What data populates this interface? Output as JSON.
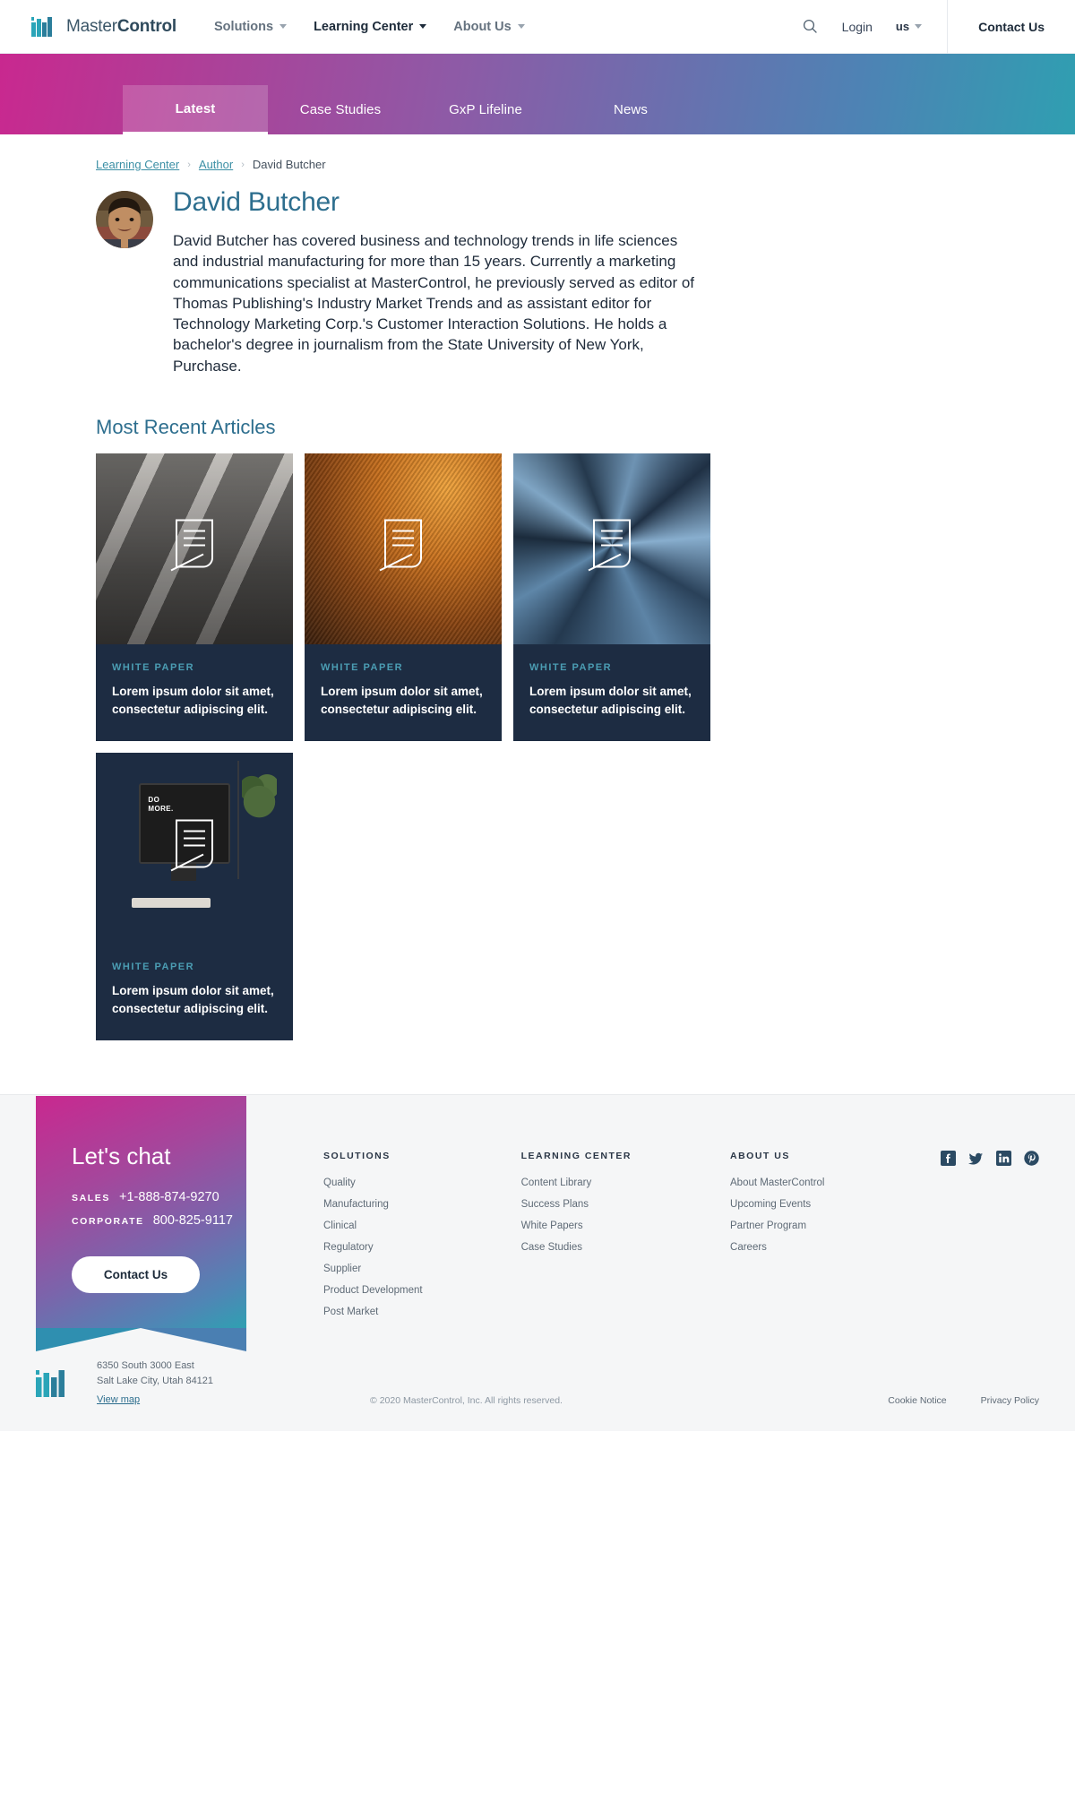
{
  "header": {
    "logo": {
      "icon": "mastercontrol-logo-icon",
      "text_light": "Master",
      "text_bold": "Control"
    },
    "nav": [
      {
        "label": "Solutions",
        "active": false,
        "has_caret": true
      },
      {
        "label": "Learning Center",
        "active": true,
        "has_caret": true
      },
      {
        "label": "About Us",
        "active": false,
        "has_caret": true
      }
    ],
    "search_icon": "search-icon",
    "login_label": "Login",
    "locale_label": "us",
    "contact_label": "Contact Us"
  },
  "tabbar": {
    "tabs": [
      {
        "label": "Latest",
        "active": true
      },
      {
        "label": "Case Studies",
        "active": false
      },
      {
        "label": "GxP Lifeline",
        "active": false
      },
      {
        "label": "News",
        "active": false
      }
    ]
  },
  "breadcrumb": {
    "items": [
      {
        "label": "Learning Center",
        "link": true
      },
      {
        "label": "Author",
        "link": true
      },
      {
        "label": "David Butcher",
        "link": false
      }
    ],
    "separator": "›"
  },
  "author": {
    "name": "David Butcher",
    "avatar_alt": "author-photo",
    "bio": "David Butcher has covered business and technology trends in life sciences and industrial manufacturing for more than 15 years. Currently a marketing communications specialist at MasterControl, he previously served as editor of Thomas Publishing's Industry Market Trends and as assistant editor for Technology Marketing Corp.'s Customer Interaction Solutions. He holds a bachelor's degree in journalism from the State University of New York, Purchase."
  },
  "articles": {
    "section_title": "Most Recent Articles",
    "cards": [
      {
        "kicker": "WHITE PAPER",
        "title": "Lorem ipsum dolor sit amet, consectetur adipiscing elit.",
        "image": "crowd-stairs-photo"
      },
      {
        "kicker": "WHITE PAPER",
        "title": "Lorem ipsum dolor sit amet, consectetur adipiscing elit.",
        "image": "amber-interior-photo"
      },
      {
        "kicker": "WHITE PAPER",
        "title": "Lorem ipsum dolor sit amet, consectetur adipiscing elit.",
        "image": "skyscrapers-photo"
      },
      {
        "kicker": "WHITE PAPER",
        "title": "Lorem ipsum dolor sit amet, consectetur adipiscing elit.",
        "image": "desk-monitor-photo"
      }
    ]
  },
  "footer": {
    "chat": {
      "title": "Let's chat",
      "sales_label": "SALES",
      "sales_number": "+1-888-874-9270",
      "corporate_label": "CORPORATE",
      "corporate_number": "800-825-9117",
      "button_label": "Contact Us"
    },
    "columns": [
      {
        "title": "SOLUTIONS",
        "links": [
          "Quality",
          "Manufacturing",
          "Clinical",
          "Regulatory",
          "Supplier",
          "Product Development",
          "Post Market"
        ]
      },
      {
        "title": "LEARNING CENTER",
        "links": [
          "Content Library",
          "Success Plans",
          "White Papers",
          "Case Studies"
        ]
      },
      {
        "title": "ABOUT US",
        "links": [
          "About MasterControl",
          "Upcoming Events",
          "Partner Program",
          "Careers"
        ]
      }
    ],
    "socials": [
      {
        "name": "facebook-icon"
      },
      {
        "name": "twitter-icon"
      },
      {
        "name": "linkedin-icon"
      },
      {
        "name": "pinterest-icon"
      }
    ],
    "address_line1": "6350 South 3000 East",
    "address_line2": "Salt Lake City, Utah 84121",
    "view_map_label": "View map",
    "copyright": "© 2020 MasterControl, Inc. All rights reserved.",
    "legal": [
      "Cookie Notice",
      "Privacy Policy"
    ]
  },
  "colors": {
    "accent_teal": "#4b9db3",
    "card_navy": "#1d2c42",
    "heading_blue": "#2d6e8e",
    "gradient_start": "#c9288f",
    "gradient_end": "#2f9fb1"
  }
}
